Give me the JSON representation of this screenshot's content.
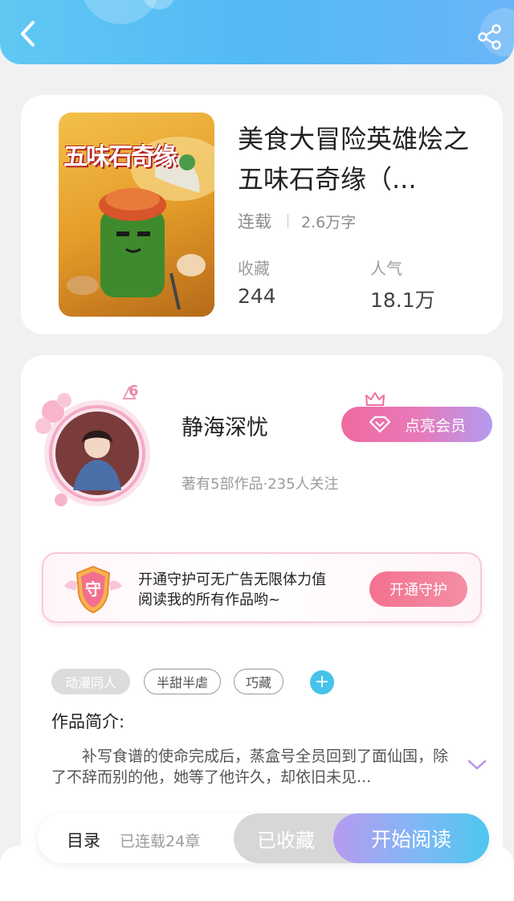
{
  "header": {
    "back_icon": "chevron-left-icon",
    "share_icon": "share-icon",
    "colors": {
      "start": "#60c8f3",
      "end": "#6ab5f7"
    }
  },
  "book": {
    "title": "美食大冒险英雄烩之五味石奇缘（...",
    "cover_title": "五味石奇缘",
    "status": "连载",
    "word_count": "2.6万字",
    "stats": [
      {
        "label": "收藏",
        "value": "244"
      },
      {
        "label": "人气",
        "value": "18.1万"
      }
    ]
  },
  "author": {
    "name": "静海深忧",
    "meta": "著有5部作品·235人关注",
    "level": "6",
    "vip_button": "点亮会员"
  },
  "guard": {
    "badge": "守",
    "text_line1": "开通守护可无广告无限体力值",
    "text_line2": "阅读我的所有作品哟~",
    "button": "开通守护"
  },
  "tags": [
    "动漫同人",
    "半甜半虐",
    "巧藏"
  ],
  "tag_add": "+",
  "synopsis": {
    "label": "作品简介:",
    "text": "补写食谱的使命完成后，蒸盒号全员回到了面仙国，除了不辞而别的他，她等了他许久，却依旧未见..."
  },
  "bottom_bar": {
    "toc_label": "目录",
    "chapter_count": "已连载24章",
    "collected_button": "已收藏",
    "read_button": "开始阅读"
  }
}
